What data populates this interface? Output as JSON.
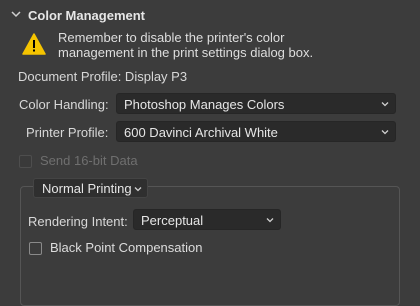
{
  "section": {
    "title": "Color Management",
    "icon": "chevron-down-icon"
  },
  "warning": {
    "icon": "warning-icon",
    "line1": "Remember to disable the printer's color",
    "line2": "management in the print settings dialog box."
  },
  "document_profile": "Document Profile: Display P3",
  "color_handling": {
    "label": "Color Handling:",
    "value": "Photoshop Manages Colors"
  },
  "printer_profile": {
    "label": "Printer Profile:",
    "value": "600 Davinci Archival White"
  },
  "send_16bit": {
    "label": "Send 16-bit Data",
    "checked": false,
    "enabled": false
  },
  "printing_mode": {
    "value": "Normal Printing"
  },
  "rendering_intent": {
    "label": "Rendering Intent:",
    "value": "Perceptual"
  },
  "black_point": {
    "label": "Black Point Compensation",
    "checked": false
  },
  "colors": {
    "background": "#3c3c3c",
    "select_bg": "#2a2a2a",
    "warning_yellow": "#f5c400"
  }
}
